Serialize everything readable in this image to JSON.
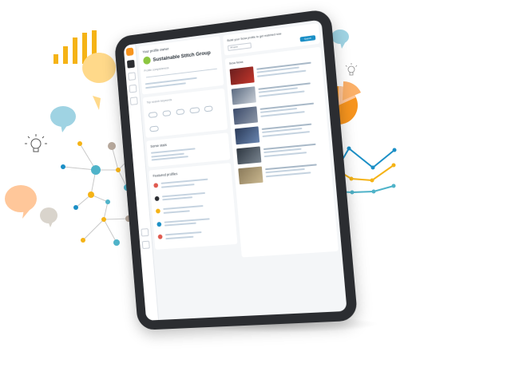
{
  "colors": {
    "accent_orange": "#f7941d",
    "accent_yellow": "#f5b316",
    "accent_blue": "#1b8fc6",
    "accent_teal": "#4fb3c9",
    "bubble_blue": "#9fd3e3",
    "bubble_yellow": "#ffd98a",
    "bubble_peach": "#ffc79a",
    "bubble_grey": "#d9d4cc",
    "org_green": "#8cc63f",
    "node_grey": "#b7a89c"
  },
  "icons": {
    "bar_chart": "bar-chart-icon",
    "pie_chart": "pie-chart-icon",
    "line_chart": "line-chart-icon",
    "lightbulb": "lightbulb-icon",
    "speech_bubble": "speech-bubble-icon",
    "network": "network-graph-icon"
  },
  "app": {
    "profile_label": "Your profile owner",
    "org_name": "Sustainable Stitch Group",
    "completeness_label": "Profile completeness",
    "keywords_label": "Top search keywords",
    "score_label": "Some stats",
    "profiles_heading": "Featured profiles",
    "search_prompt": "Build your Sesa profile to get matched now",
    "search_select": "All types",
    "search_button": "Search",
    "news_heading": "Sesa News"
  }
}
